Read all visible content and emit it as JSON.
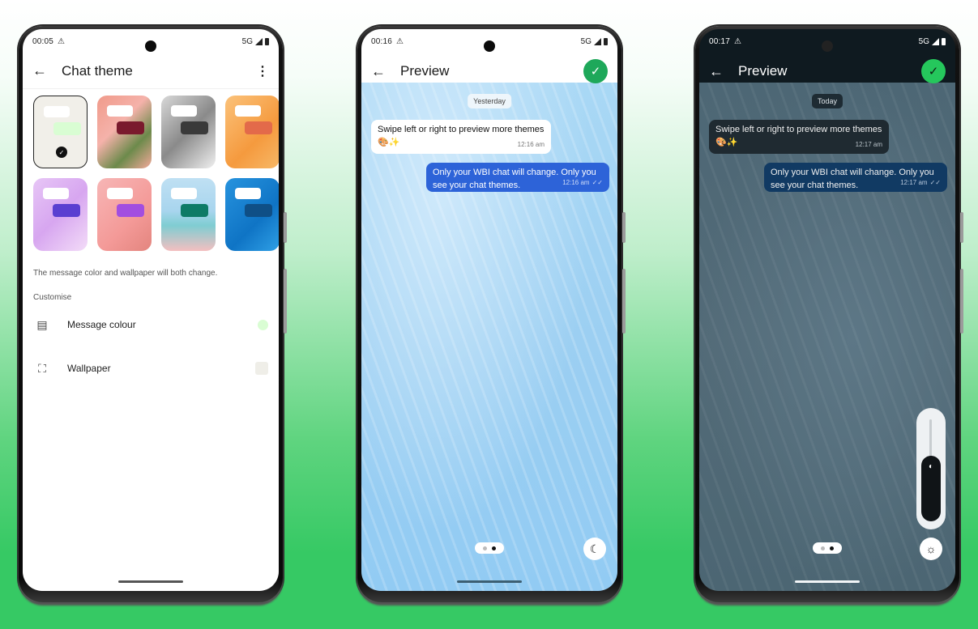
{
  "phones": [
    {
      "status": {
        "time": "00:05",
        "warning_icon": "⚠",
        "network": "5G"
      },
      "appbar": {
        "back_icon": "←",
        "title": "Chat theme",
        "menu_icon": "⋮"
      },
      "themes": [
        {
          "name": "default",
          "wallpaper": "#f1efe9",
          "bubble_out": "#d9fdd3",
          "selected": true
        },
        {
          "name": "tulip",
          "wallpaper": "linear-gradient(135deg,#f09a8a,#f5b2aa 40%,#6c8a4b 70%,#f3a99a)",
          "bubble_out": "#7a1a2d",
          "selected": false
        },
        {
          "name": "monochrome",
          "wallpaper": "linear-gradient(135deg,#d9d9d9,#8a8a8a 50%,#f0f0f0)",
          "bubble_out": "#3a3a3a",
          "selected": false
        },
        {
          "name": "citrus",
          "wallpaper": "linear-gradient(135deg,#fbc27a,#f59a3e 60%,#f7b867)",
          "bubble_out": "#e36a4a",
          "selected": false
        },
        {
          "name": "lavender",
          "wallpaper": "linear-gradient(135deg,#e7c6f6,#d7a6f0 50%,#f3dcf8)",
          "bubble_out": "#5a3fd1",
          "selected": false
        },
        {
          "name": "blossom",
          "wallpaper": "linear-gradient(135deg,#f7b6b6,#f49a98 60%,#e3857e)",
          "bubble_out": "#a24ee0",
          "selected": false
        },
        {
          "name": "beach",
          "wallpaper": "linear-gradient(180deg,#bfe0f3,#a8d5ee 45%,#7fcdd2 65%,#f4bfc0)",
          "bubble_out": "#0e7b66",
          "selected": false
        },
        {
          "name": "ocean",
          "wallpaper": "linear-gradient(135deg,#2793de,#0f74c5 60%,#2fa0e6)",
          "bubble_out": "#0f4f86",
          "selected": false
        }
      ],
      "selected_check_icon": "✓",
      "helper_text": "The message color and wallpaper will both change.",
      "section_label": "Customise",
      "settings": [
        {
          "icon": "message-icon",
          "glyph": "▤",
          "label": "Message colour",
          "value_color": "#d9fdd3"
        },
        {
          "icon": "wallpaper-icon",
          "glyph": "⛶",
          "label": "Wallpaper",
          "value_color": "#efeee8"
        }
      ]
    },
    {
      "status": {
        "time": "00:16",
        "warning_icon": "⚠",
        "network": "5G"
      },
      "appbar": {
        "back_icon": "←",
        "title": "Preview",
        "confirm_icon": "✓"
      },
      "date_label": "Yesterday",
      "messages": [
        {
          "direction": "incoming",
          "text": "Swipe left or right to preview more themes 🎨✨",
          "time": "12:16 am"
        },
        {
          "direction": "outgoing",
          "text": "Only your WBI chat will change. Only you see your chat themes.",
          "time": "12:16 am",
          "ticks": "✓✓"
        }
      ],
      "pager": {
        "pages": 2,
        "active": 2
      },
      "mode_icon": "☾"
    },
    {
      "status": {
        "time": "00:17",
        "warning_icon": "⚠",
        "network": "5G"
      },
      "appbar": {
        "back_icon": "←",
        "title": "Preview",
        "confirm_icon": "✓"
      },
      "date_label": "Today",
      "messages": [
        {
          "direction": "incoming",
          "text": "Swipe left or right to preview more themes 🎨✨",
          "time": "12:17 am"
        },
        {
          "direction": "outgoing",
          "text": "Only your WBI chat will change. Only you see your chat themes.",
          "time": "12:17 am",
          "ticks": "✓✓"
        }
      ],
      "pager": {
        "pages": 2,
        "active": 2
      },
      "brightness": {
        "level_percent": 62,
        "icon": "◐"
      },
      "mode_icon": "☼"
    }
  ]
}
